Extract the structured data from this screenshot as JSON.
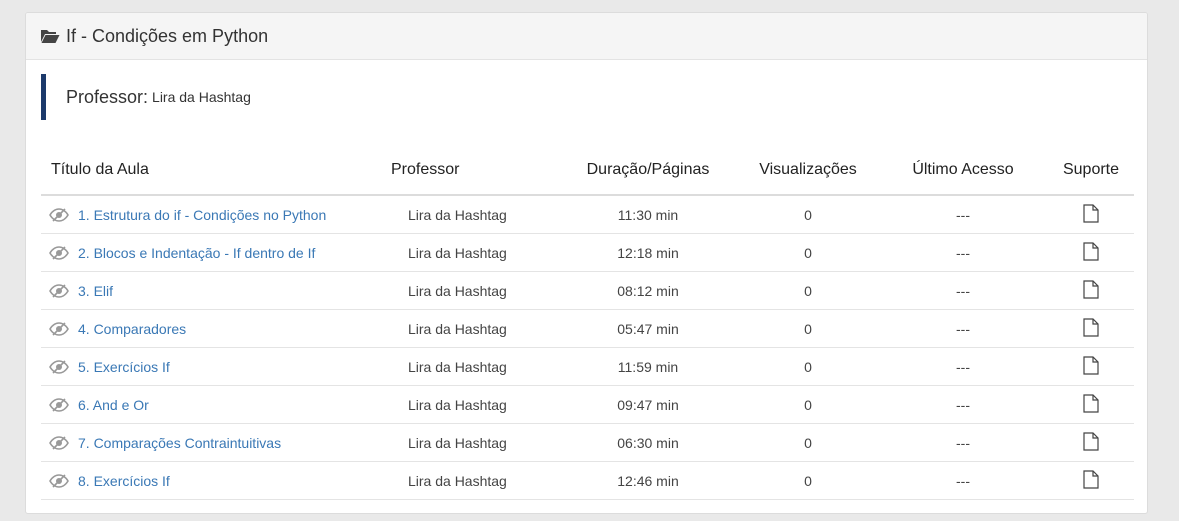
{
  "course": {
    "title": "If - Condições em Python",
    "title_icon": "folder-open-icon",
    "professor_label": "Professor:",
    "professor_name": "Lira da Hashtag"
  },
  "table": {
    "headers": {
      "title": "Título da Aula",
      "professor": "Professor",
      "duration": "Duração/Páginas",
      "views": "Visualizações",
      "last_access": "Último Acesso",
      "support": "Suporte"
    },
    "row_icon": "eye-slash-icon",
    "support_icon": "file-icon",
    "rows": [
      {
        "title": "1. Estrutura do if - Condições no Python",
        "professor": "Lira da Hashtag",
        "duration": "11:30 min",
        "views": "0",
        "last_access": "---"
      },
      {
        "title": "2. Blocos e Indentação - If dentro de If",
        "professor": "Lira da Hashtag",
        "duration": "12:18 min",
        "views": "0",
        "last_access": "---"
      },
      {
        "title": "3. Elif",
        "professor": "Lira da Hashtag",
        "duration": "08:12 min",
        "views": "0",
        "last_access": "---"
      },
      {
        "title": "4. Comparadores",
        "professor": "Lira da Hashtag",
        "duration": "05:47 min",
        "views": "0",
        "last_access": "---"
      },
      {
        "title": "5. Exercícios If",
        "professor": "Lira da Hashtag",
        "duration": "11:59 min",
        "views": "0",
        "last_access": "---"
      },
      {
        "title": "6. And e Or",
        "professor": "Lira da Hashtag",
        "duration": "09:47 min",
        "views": "0",
        "last_access": "---"
      },
      {
        "title": "7. Comparações Contraintuitivas",
        "professor": "Lira da Hashtag",
        "duration": "06:30 min",
        "views": "0",
        "last_access": "---"
      },
      {
        "title": "8. Exercícios If",
        "professor": "Lira da Hashtag",
        "duration": "12:46 min",
        "views": "0",
        "last_access": "---"
      }
    ]
  },
  "colors": {
    "accent_border": "#1c3a6b",
    "link": "#3a78b5"
  }
}
